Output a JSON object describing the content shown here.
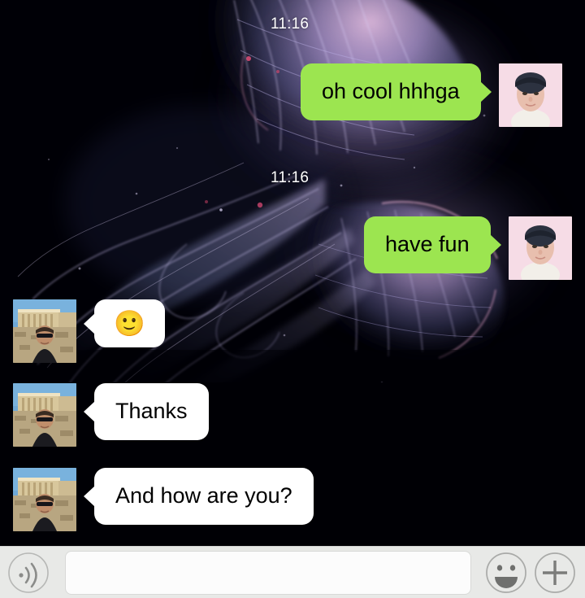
{
  "app": {
    "name": "chat-conversation",
    "background_color": "#000000",
    "outgoing_bubble_color": "#9ce550",
    "incoming_bubble_color": "#ffffff",
    "composer_background_color": "#e8e9e7"
  },
  "wallpaper": {
    "description": "jellyfish-photo",
    "base_color": "#000000",
    "accent_color": "#b9a8e8"
  },
  "messages": [
    {
      "id": "msg-1",
      "direction": "outgoing",
      "timestamp": "11:16",
      "text": "oh cool hhhga",
      "avatar": "self-avatar"
    },
    {
      "id": "msg-2",
      "direction": "outgoing",
      "timestamp": "11:16",
      "text": "have fun",
      "avatar": "self-avatar"
    },
    {
      "id": "msg-3",
      "direction": "incoming",
      "text": "🙂",
      "is_emoji_only": true,
      "avatar": "contact-avatar"
    },
    {
      "id": "msg-4",
      "direction": "incoming",
      "text": "Thanks",
      "avatar": "contact-avatar"
    },
    {
      "id": "msg-5",
      "direction": "incoming",
      "text": "And how are you?",
      "avatar": "contact-avatar"
    }
  ],
  "composer": {
    "voice_icon": "voice-wave-icon",
    "emoji_icon": "smiley-face-icon",
    "attach_icon": "plus-icon",
    "input_value": "",
    "input_placeholder": ""
  }
}
